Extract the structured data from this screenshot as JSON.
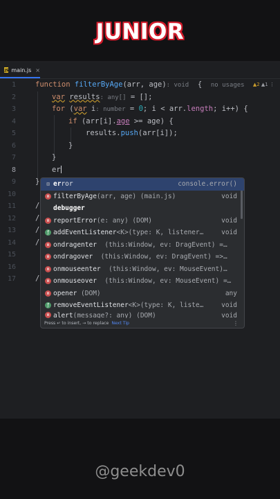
{
  "headline": "JUNIOR",
  "tab": {
    "icon": "JS",
    "label": "main.js",
    "close": "×"
  },
  "inspections": {
    "warnings": "2",
    "weak": "1"
  },
  "line_numbers": [
    "1",
    "2",
    "3",
    "4",
    "5",
    "6",
    "7",
    "8",
    "9",
    "10",
    "11",
    "12",
    "13",
    "14",
    "15",
    "16",
    "17"
  ],
  "code": {
    "l1": {
      "kw": "function",
      "name": "filterByAge",
      "params": "(arr, age)",
      "type_hint": ": void",
      "brace": "{",
      "usages": "no usages"
    },
    "l2": {
      "kw": "var",
      "name": "results",
      "type_hint": ": any[]",
      "rest": " = [];"
    },
    "l3": {
      "kw": "for",
      "open": " (",
      "kw2": "var",
      "var": " i",
      "type_hint": ": number",
      "eq": " = ",
      "zero": "0",
      "rest1": "; i < arr.",
      "length": "length",
      "rest2": "; i++) {"
    },
    "l4": {
      "kw": "if",
      "pre": " (arr[i].",
      "age": "age",
      "post": " >= age) {"
    },
    "l5": {
      "obj": "results.",
      "method": "push",
      "rest": "(arr[i]);"
    },
    "l6": "}",
    "l7": "}",
    "l8": "er",
    "l9": "}",
    "slashes": [
      "/",
      "/",
      "/",
      "/",
      "/"
    ]
  },
  "completion": {
    "items": [
      {
        "icon": "template-icon",
        "name_bold": "er",
        "name": "ror",
        "sig": "",
        "type": "console.error()"
      },
      {
        "icon": "method-icon",
        "name_bold": "",
        "name": "filterByAge",
        "sig": "(arr, age) (main.js)",
        "type": "void"
      },
      {
        "icon": "none",
        "name_bold": "debugger",
        "name": "",
        "sig": "",
        "type": ""
      },
      {
        "icon": "method-icon",
        "name_bold": "",
        "name": "reportError",
        "sig": "(e: any) (DOM)",
        "type": "void"
      },
      {
        "icon": "function-icon",
        "name_bold": "",
        "name": "addEventListener",
        "sig": "<K>(type: K, listener…",
        "type": "void"
      },
      {
        "icon": "method-icon",
        "name_bold": "",
        "name": "ondragenter",
        "sig": "  (this:Window, ev: DragEvent) =…",
        "type": ""
      },
      {
        "icon": "method-icon",
        "name_bold": "",
        "name": "ondragover",
        "sig": "  (this:Window, ev: DragEvent) =>…",
        "type": ""
      },
      {
        "icon": "method-icon",
        "name_bold": "",
        "name": "onmouseenter",
        "sig": "  (this:Window, ev: MouseEvent)…",
        "type": ""
      },
      {
        "icon": "method-icon",
        "name_bold": "",
        "name": "onmouseover",
        "sig": "  (this:Window, ev: MouseEvent) =…",
        "type": ""
      },
      {
        "icon": "method-icon",
        "name_bold": "",
        "name": "opener",
        "sig": " (DOM)",
        "type": "any"
      },
      {
        "icon": "function-icon",
        "name_bold": "",
        "name": "removeEventListener",
        "sig": "<K>(type: K, liste…",
        "type": "void"
      },
      {
        "icon": "method-icon",
        "name_bold": "",
        "name": "alert",
        "sig": "(message?: any) (DOM)",
        "type": "void"
      }
    ],
    "footer": {
      "hint": "Press ↵ to insert, → to replace",
      "tip": "Next Tip",
      "more": "⋮"
    }
  },
  "handle": "@geekdev0",
  "colors": {
    "accent": "#d11a2a",
    "selection": "#2e436e",
    "keyword": "#cf8e6d",
    "function": "#56a8f5"
  }
}
